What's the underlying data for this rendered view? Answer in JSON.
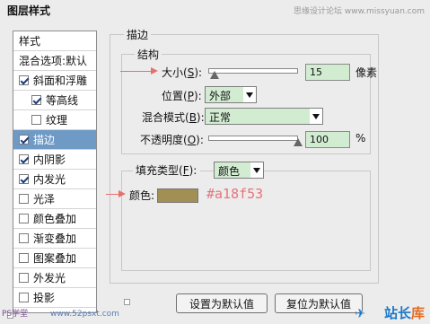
{
  "window": {
    "title": "图层样式",
    "watermark_top": "思缘设计论坛 www.missyuan.com"
  },
  "sidebar": {
    "items": [
      {
        "label": "样式",
        "header": true
      },
      {
        "label": "混合选项:默认",
        "header": true
      },
      {
        "label": "斜面和浮雕",
        "checked": true
      },
      {
        "label": "等高线",
        "checked": true,
        "indent": true
      },
      {
        "label": "纹理",
        "checked": false,
        "indent": true
      },
      {
        "label": "描边",
        "checked": true,
        "selected": true
      },
      {
        "label": "内阴影",
        "checked": true
      },
      {
        "label": "内发光",
        "checked": true
      },
      {
        "label": "光泽",
        "checked": false
      },
      {
        "label": "颜色叠加",
        "checked": false
      },
      {
        "label": "渐变叠加",
        "checked": false
      },
      {
        "label": "图案叠加",
        "checked": false
      },
      {
        "label": "外发光",
        "checked": false
      },
      {
        "label": "投影",
        "checked": false
      }
    ]
  },
  "stroke": {
    "section_title": "描边",
    "structure_title": "结构",
    "size_label": "大小(",
    "size_key": "S",
    "size_label_end": "):",
    "size_value": "15",
    "size_unit": "像素",
    "size_slider_fraction": 0.07,
    "position_label": "位置(",
    "position_key": "P",
    "position_label_end": "):",
    "position_value": "外部",
    "blend_label": "混合模式(",
    "blend_key": "B",
    "blend_label_end": "):",
    "blend_value": "正常",
    "opacity_label": "不透明度(",
    "opacity_key": "O",
    "opacity_label_end": "):",
    "opacity_value": "100",
    "opacity_unit": "%",
    "opacity_slider_fraction": 1.0,
    "fill_type_label": "填充类型(",
    "fill_type_key": "F",
    "fill_type_label_end": "):",
    "fill_type_value": "颜色",
    "color_label": "颜色:",
    "color_hex": "#a18f53",
    "color_hex_text": "#a18f53"
  },
  "buttons": {
    "set_default": "设置为默认值",
    "reset_default": "复位为默认值"
  },
  "watermarks": {
    "bottom_left": "PS学堂",
    "bottom_site": "www.52psxt.com",
    "logo_bird": "✈",
    "logo_zhan": "站长",
    "logo_ku": "库"
  },
  "colors": {
    "accent_arrow": "#e7706d",
    "selection": "#6f9ac6",
    "field_green": "#d2ecd2"
  }
}
